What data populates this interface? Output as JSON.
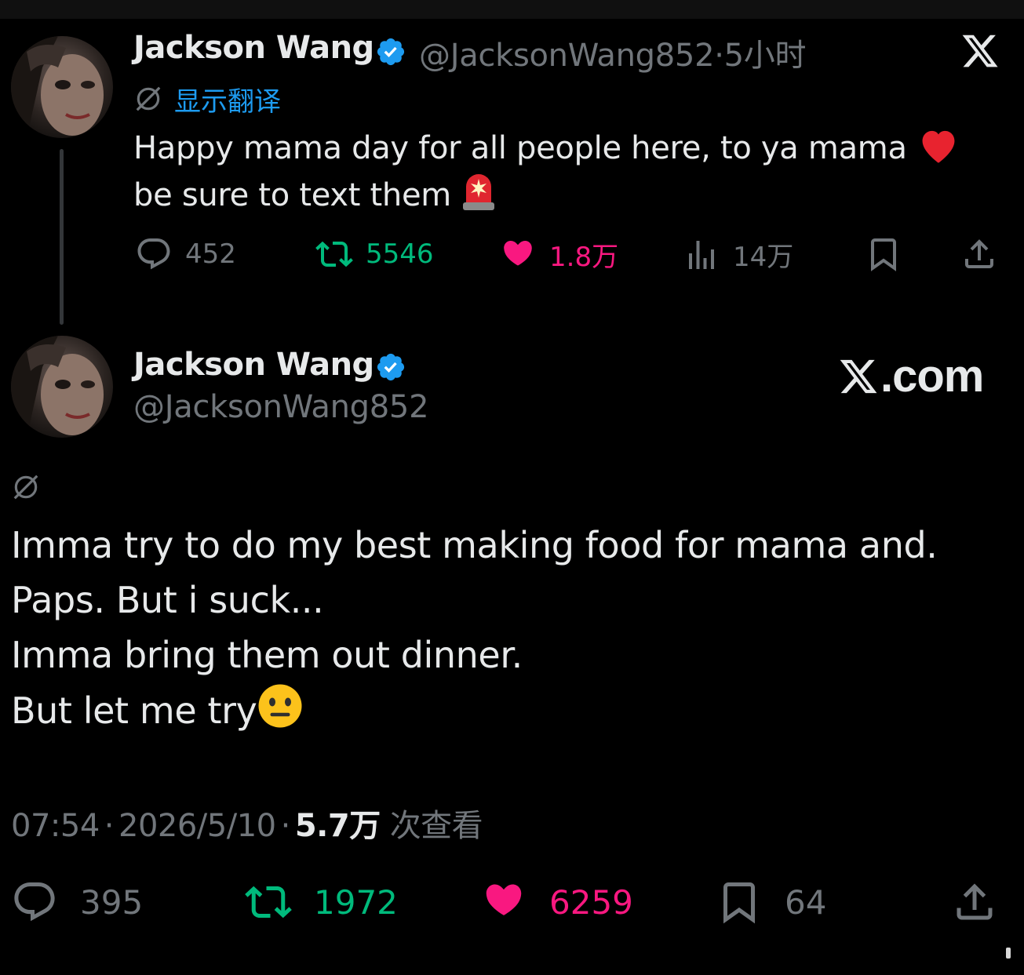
{
  "brand_colors": {
    "background": "#000000",
    "text": "#e7e9ea",
    "muted": "#71767b",
    "link": "#1d9bf0",
    "retweet": "#00ba7c",
    "like": "#f91880",
    "verified": "#1d9bf0"
  },
  "tweet1": {
    "author_name": "Jackson Wang",
    "handle": "@JacksonWang852",
    "separator": "·",
    "time_ago": "5小时",
    "translate_label": "显示翻译",
    "text_lines": [
      "Happy mama day for all people here, to ya mama",
      "be sure to text them"
    ],
    "emojis": [
      "red-heart-emoji",
      "police-light-emoji"
    ],
    "stats": {
      "replies": "452",
      "retweets": "5546",
      "likes": "1.8万",
      "views": "14万"
    }
  },
  "tweet2": {
    "author_name": "Jackson Wang",
    "handle": "@JacksonWang852",
    "text_lines": [
      "Imma try to do my best making food for mama and.",
      "Paps. But i suck...",
      "Imma bring them out dinner.",
      "But let me try"
    ],
    "emojis": [
      "neutral-face-emoji"
    ],
    "time": "07:54",
    "separator1": "·",
    "date": "2026/5/10",
    "separator2": "·",
    "views_count": "5.7万",
    "views_label": "次查看",
    "stats": {
      "replies": "395",
      "retweets": "1972",
      "likes": "6259",
      "bookmarks": "64"
    }
  },
  "watermark": {
    "text": ".com"
  },
  "icons": [
    "x-logo-icon",
    "verified-badge-icon",
    "globe-slash-icon",
    "reply-icon",
    "retweet-icon",
    "heart-icon",
    "views-icon",
    "bookmark-icon",
    "share-icon"
  ]
}
